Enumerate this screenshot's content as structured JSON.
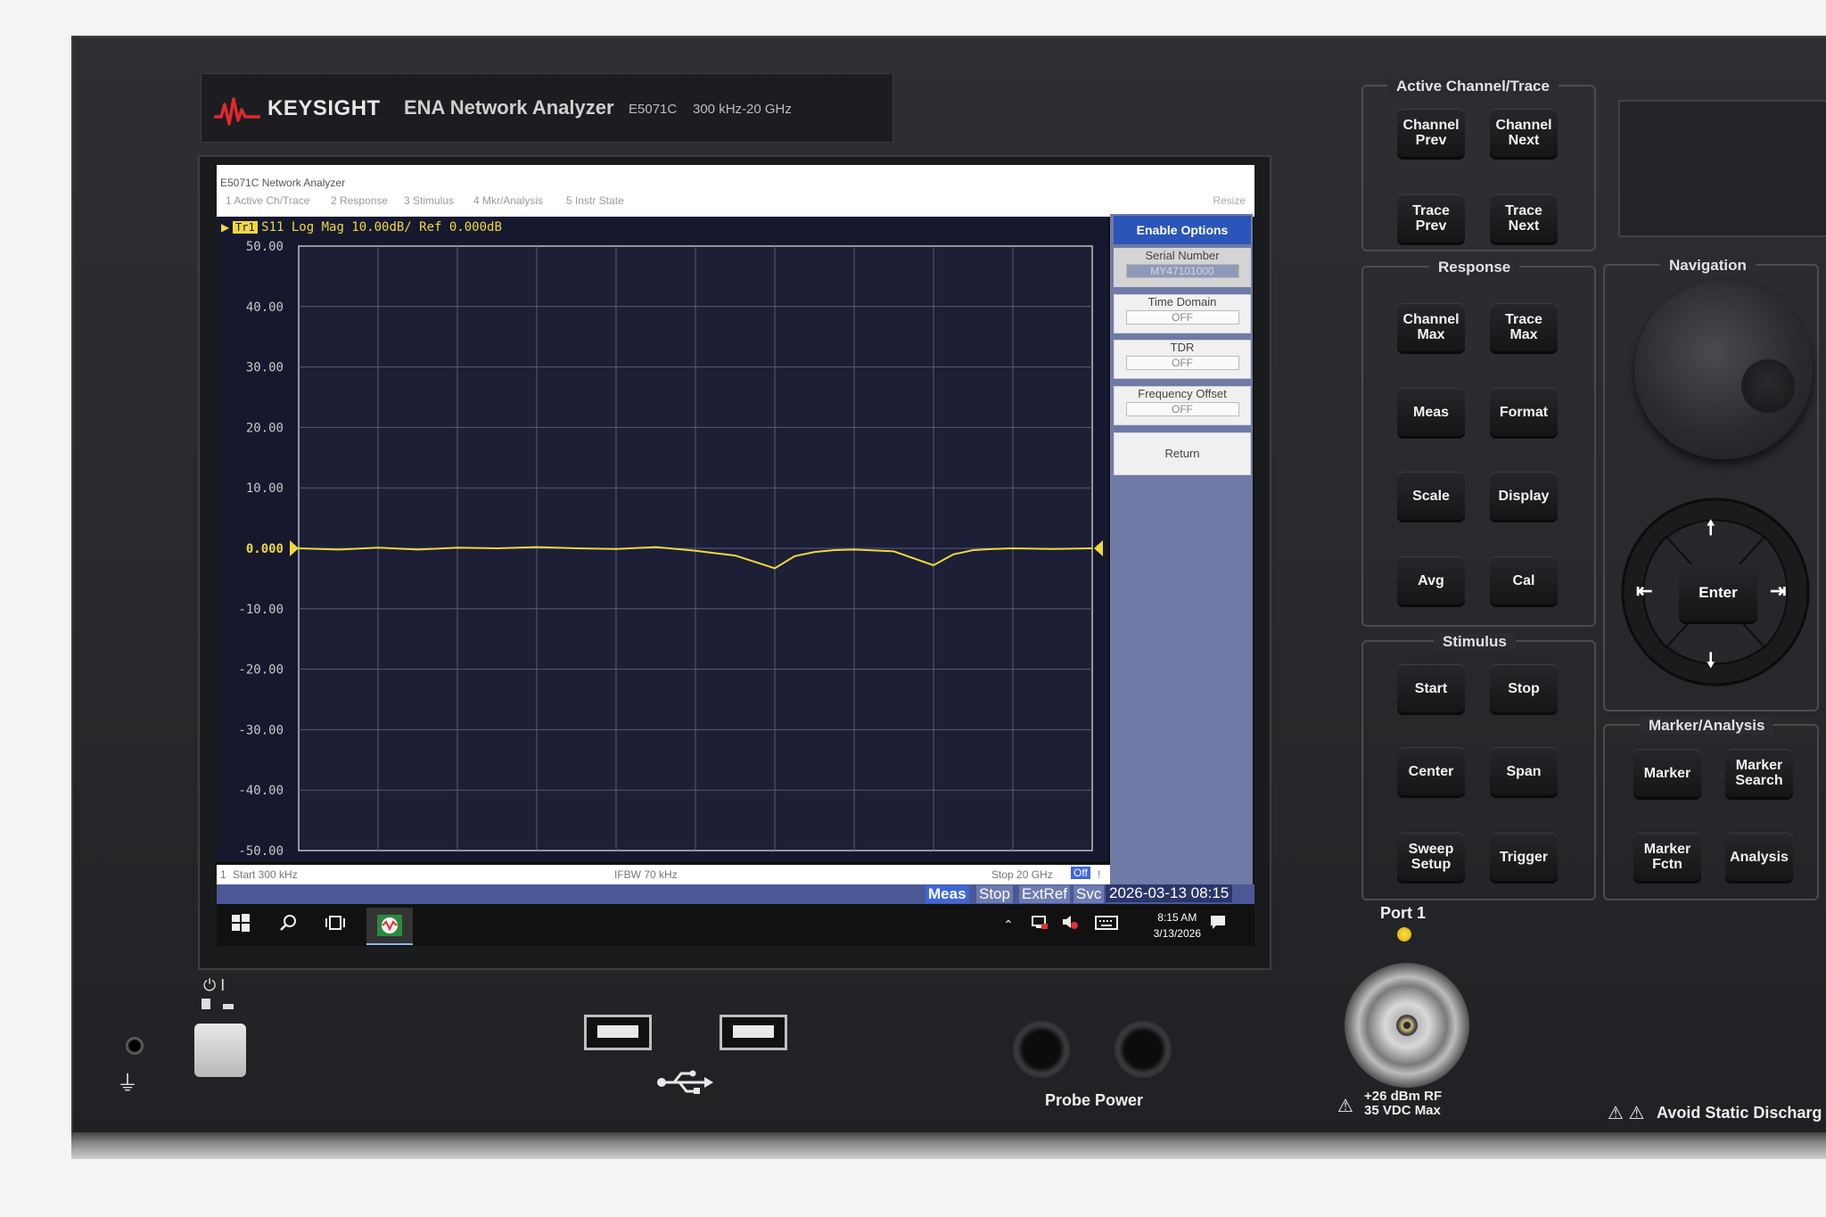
{
  "instrument": {
    "brand": "KEYSIGHT",
    "product": "ENA Network Analyzer",
    "model": "E5071C",
    "freq_range": "300 kHz-20 GHz"
  },
  "screen": {
    "window_title": "E5071C Network Analyzer",
    "menu": [
      "1 Active Ch/Trace",
      "2 Response",
      "3 Stimulus",
      "4 Mkr/Analysis",
      "5 Instr State"
    ],
    "resize": "Resize",
    "trace_tag": "Tr1",
    "trace_header": "S11 Log Mag 10.00dB/ Ref 0.000dB",
    "footer": {
      "channel": "1",
      "start": "Start 300 kHz",
      "ifbw": "IFBW 70 kHz",
      "stop": "Stop 20 GHz",
      "off": "Off",
      "bang": "!"
    },
    "softkeys": {
      "title": "Enable Options",
      "serial_label": "Serial Number",
      "serial_value": "MY47101000",
      "time_domain_label": "Time Domain",
      "time_domain_value": "OFF",
      "tdr_label": "TDR",
      "tdr_value": "OFF",
      "freq_offset_label": "Frequency Offset",
      "freq_offset_value": "OFF",
      "return": "Return"
    },
    "status": {
      "meas": "Meas",
      "stop": "Stop",
      "extref": "ExtRef",
      "svc": "Svc",
      "datetime": "2026-03-13 08:15"
    },
    "taskbar": {
      "time": "8:15 AM",
      "date": "3/13/2026",
      "icons": [
        "windows-icon",
        "search-icon",
        "task-view-icon",
        "analyzer-app-icon"
      ]
    }
  },
  "chart_data": {
    "type": "line",
    "title": "S11 Log Mag 10.00dB/ Ref 0.000dB",
    "xlabel": "",
    "ylabel": "",
    "x_start": "Start 300 kHz",
    "x_stop": "Stop 20 GHz",
    "ylim": [
      -50,
      50
    ],
    "ytick_labels": [
      "50.00",
      "40.00",
      "30.00",
      "20.00",
      "10.00",
      "0.000",
      "-10.00",
      "-20.00",
      "-30.00",
      "-40.00",
      "-50.00"
    ],
    "grid": true,
    "series": [
      {
        "color": "#f0d840",
        "x_ghz": [
          0,
          1,
          2,
          3,
          4,
          5,
          6,
          7,
          8,
          9,
          10,
          11,
          12,
          12.5,
          13,
          13.5,
          14,
          15,
          16,
          16.5,
          17,
          17.5,
          18,
          19,
          20
        ],
        "y_db": [
          0,
          -0.2,
          0.1,
          -0.2,
          0.1,
          0,
          0.2,
          0,
          -0.1,
          0.2,
          -0.4,
          -1.2,
          -3.3,
          -1.3,
          -0.6,
          -0.3,
          -0.2,
          -0.5,
          -2.8,
          -1.0,
          -0.3,
          -0.1,
          0,
          -0.1,
          0
        ]
      }
    ]
  },
  "panel": {
    "groups": {
      "active": "Active Channel/Trace",
      "response": "Response",
      "stimulus": "Stimulus",
      "navigation": "Navigation",
      "marker": "Marker/Analysis"
    },
    "keys": {
      "channel_prev": "Channel\nPrev",
      "channel_next": "Channel\nNext",
      "trace_prev": "Trace\nPrev",
      "trace_next": "Trace\nNext",
      "channel_max": "Channel\nMax",
      "trace_max": "Trace\nMax",
      "meas": "Meas",
      "format": "Format",
      "scale": "Scale",
      "display": "Display",
      "avg": "Avg",
      "cal": "Cal",
      "start": "Start",
      "stop": "Stop",
      "center": "Center",
      "span": "Span",
      "sweep_setup": "Sweep\nSetup",
      "trigger": "Trigger",
      "marker": "Marker",
      "marker_search": "Marker\nSearch",
      "marker_fctn": "Marker\nFctn",
      "analysis": "Analysis",
      "enter": "Enter"
    },
    "port_label": "Port 1",
    "rating_line1": "+26 dBm RF",
    "rating_line2": "35 VDC Max",
    "probe_power": "Probe Power",
    "static_warning": "Avoid Static Discharg"
  }
}
